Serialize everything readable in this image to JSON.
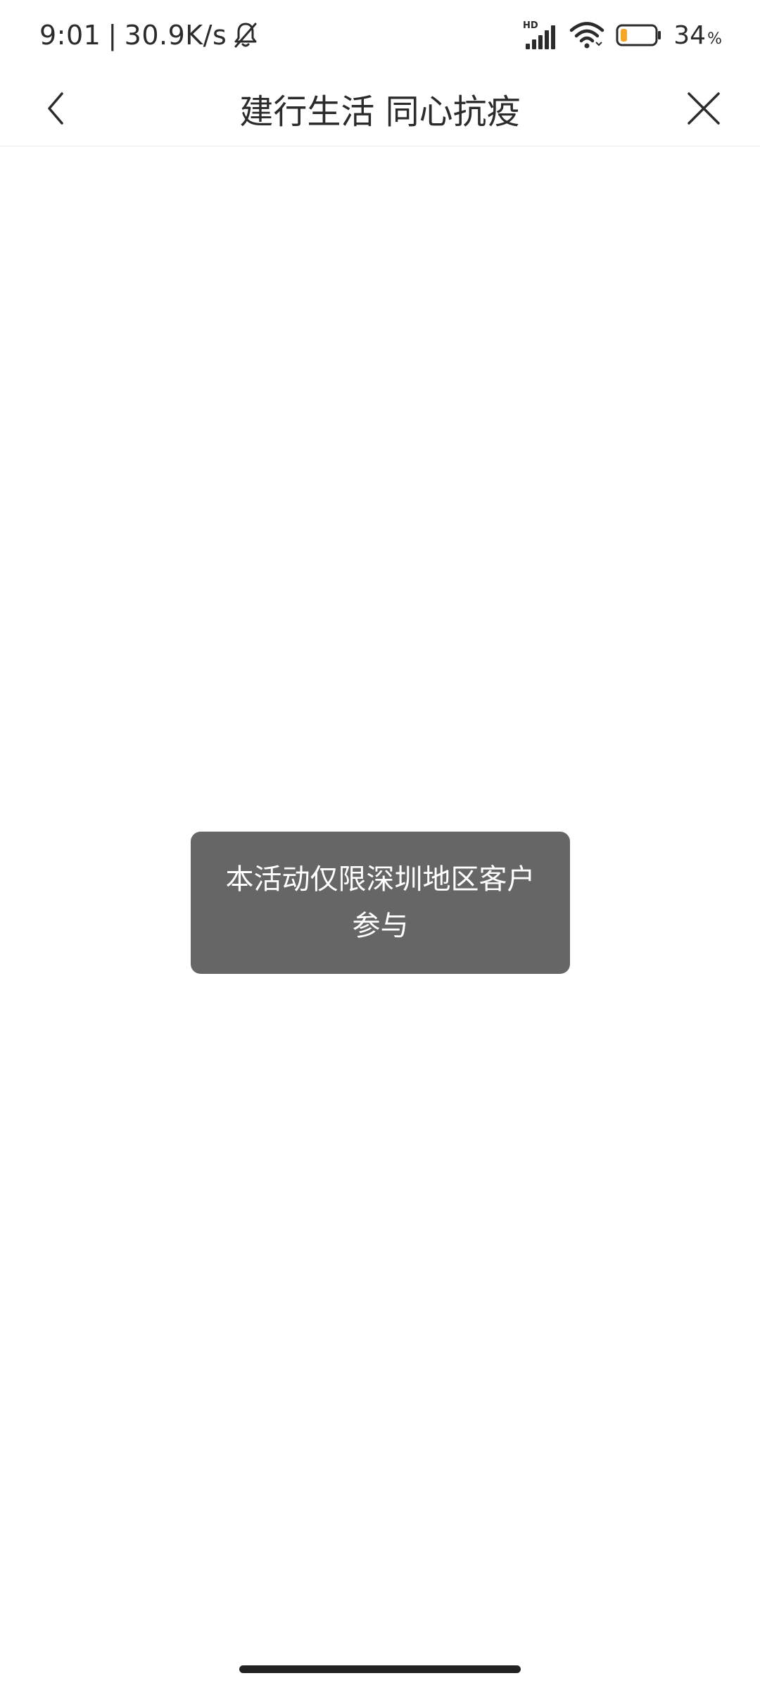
{
  "status_bar": {
    "time": "9:01",
    "separator": "|",
    "network_speed": "30.9K/s",
    "signal_label": "HD",
    "battery_percent": "34",
    "battery_percent_sign": "%",
    "battery_level": 0.34,
    "battery_color": "#f5a623",
    "icons": [
      "bell-muted-icon",
      "hd-signal-icon",
      "wifi-icon",
      "battery-icon"
    ]
  },
  "nav": {
    "title": "建行生活 同心抗疫",
    "back_icon": "chevron-left-icon",
    "close_icon": "close-icon"
  },
  "toast": {
    "message": "本活动仅限深圳地区客户参与",
    "background": "#666666"
  }
}
